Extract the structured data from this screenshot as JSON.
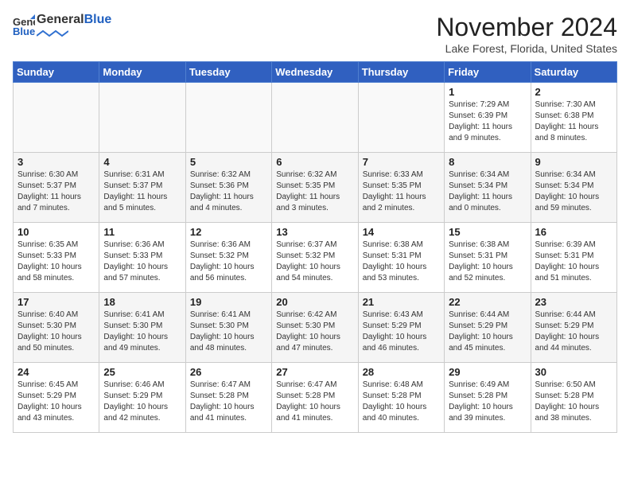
{
  "header": {
    "logo_general": "General",
    "logo_blue": "Blue",
    "month_title": "November 2024",
    "location": "Lake Forest, Florida, United States"
  },
  "days_of_week": [
    "Sunday",
    "Monday",
    "Tuesday",
    "Wednesday",
    "Thursday",
    "Friday",
    "Saturday"
  ],
  "weeks": [
    [
      {
        "day": "",
        "sunrise": "",
        "sunset": "",
        "daylight": ""
      },
      {
        "day": "",
        "sunrise": "",
        "sunset": "",
        "daylight": ""
      },
      {
        "day": "",
        "sunrise": "",
        "sunset": "",
        "daylight": ""
      },
      {
        "day": "",
        "sunrise": "",
        "sunset": "",
        "daylight": ""
      },
      {
        "day": "",
        "sunrise": "",
        "sunset": "",
        "daylight": ""
      },
      {
        "day": "1",
        "sunrise": "Sunrise: 7:29 AM",
        "sunset": "Sunset: 6:39 PM",
        "daylight": "Daylight: 11 hours and 9 minutes."
      },
      {
        "day": "2",
        "sunrise": "Sunrise: 7:30 AM",
        "sunset": "Sunset: 6:38 PM",
        "daylight": "Daylight: 11 hours and 8 minutes."
      }
    ],
    [
      {
        "day": "3",
        "sunrise": "Sunrise: 6:30 AM",
        "sunset": "Sunset: 5:37 PM",
        "daylight": "Daylight: 11 hours and 7 minutes."
      },
      {
        "day": "4",
        "sunrise": "Sunrise: 6:31 AM",
        "sunset": "Sunset: 5:37 PM",
        "daylight": "Daylight: 11 hours and 5 minutes."
      },
      {
        "day": "5",
        "sunrise": "Sunrise: 6:32 AM",
        "sunset": "Sunset: 5:36 PM",
        "daylight": "Daylight: 11 hours and 4 minutes."
      },
      {
        "day": "6",
        "sunrise": "Sunrise: 6:32 AM",
        "sunset": "Sunset: 5:35 PM",
        "daylight": "Daylight: 11 hours and 3 minutes."
      },
      {
        "day": "7",
        "sunrise": "Sunrise: 6:33 AM",
        "sunset": "Sunset: 5:35 PM",
        "daylight": "Daylight: 11 hours and 2 minutes."
      },
      {
        "day": "8",
        "sunrise": "Sunrise: 6:34 AM",
        "sunset": "Sunset: 5:34 PM",
        "daylight": "Daylight: 11 hours and 0 minutes."
      },
      {
        "day": "9",
        "sunrise": "Sunrise: 6:34 AM",
        "sunset": "Sunset: 5:34 PM",
        "daylight": "Daylight: 10 hours and 59 minutes."
      }
    ],
    [
      {
        "day": "10",
        "sunrise": "Sunrise: 6:35 AM",
        "sunset": "Sunset: 5:33 PM",
        "daylight": "Daylight: 10 hours and 58 minutes."
      },
      {
        "day": "11",
        "sunrise": "Sunrise: 6:36 AM",
        "sunset": "Sunset: 5:33 PM",
        "daylight": "Daylight: 10 hours and 57 minutes."
      },
      {
        "day": "12",
        "sunrise": "Sunrise: 6:36 AM",
        "sunset": "Sunset: 5:32 PM",
        "daylight": "Daylight: 10 hours and 56 minutes."
      },
      {
        "day": "13",
        "sunrise": "Sunrise: 6:37 AM",
        "sunset": "Sunset: 5:32 PM",
        "daylight": "Daylight: 10 hours and 54 minutes."
      },
      {
        "day": "14",
        "sunrise": "Sunrise: 6:38 AM",
        "sunset": "Sunset: 5:31 PM",
        "daylight": "Daylight: 10 hours and 53 minutes."
      },
      {
        "day": "15",
        "sunrise": "Sunrise: 6:38 AM",
        "sunset": "Sunset: 5:31 PM",
        "daylight": "Daylight: 10 hours and 52 minutes."
      },
      {
        "day": "16",
        "sunrise": "Sunrise: 6:39 AM",
        "sunset": "Sunset: 5:31 PM",
        "daylight": "Daylight: 10 hours and 51 minutes."
      }
    ],
    [
      {
        "day": "17",
        "sunrise": "Sunrise: 6:40 AM",
        "sunset": "Sunset: 5:30 PM",
        "daylight": "Daylight: 10 hours and 50 minutes."
      },
      {
        "day": "18",
        "sunrise": "Sunrise: 6:41 AM",
        "sunset": "Sunset: 5:30 PM",
        "daylight": "Daylight: 10 hours and 49 minutes."
      },
      {
        "day": "19",
        "sunrise": "Sunrise: 6:41 AM",
        "sunset": "Sunset: 5:30 PM",
        "daylight": "Daylight: 10 hours and 48 minutes."
      },
      {
        "day": "20",
        "sunrise": "Sunrise: 6:42 AM",
        "sunset": "Sunset: 5:30 PM",
        "daylight": "Daylight: 10 hours and 47 minutes."
      },
      {
        "day": "21",
        "sunrise": "Sunrise: 6:43 AM",
        "sunset": "Sunset: 5:29 PM",
        "daylight": "Daylight: 10 hours and 46 minutes."
      },
      {
        "day": "22",
        "sunrise": "Sunrise: 6:44 AM",
        "sunset": "Sunset: 5:29 PM",
        "daylight": "Daylight: 10 hours and 45 minutes."
      },
      {
        "day": "23",
        "sunrise": "Sunrise: 6:44 AM",
        "sunset": "Sunset: 5:29 PM",
        "daylight": "Daylight: 10 hours and 44 minutes."
      }
    ],
    [
      {
        "day": "24",
        "sunrise": "Sunrise: 6:45 AM",
        "sunset": "Sunset: 5:29 PM",
        "daylight": "Daylight: 10 hours and 43 minutes."
      },
      {
        "day": "25",
        "sunrise": "Sunrise: 6:46 AM",
        "sunset": "Sunset: 5:29 PM",
        "daylight": "Daylight: 10 hours and 42 minutes."
      },
      {
        "day": "26",
        "sunrise": "Sunrise: 6:47 AM",
        "sunset": "Sunset: 5:28 PM",
        "daylight": "Daylight: 10 hours and 41 minutes."
      },
      {
        "day": "27",
        "sunrise": "Sunrise: 6:47 AM",
        "sunset": "Sunset: 5:28 PM",
        "daylight": "Daylight: 10 hours and 41 minutes."
      },
      {
        "day": "28",
        "sunrise": "Sunrise: 6:48 AM",
        "sunset": "Sunset: 5:28 PM",
        "daylight": "Daylight: 10 hours and 40 minutes."
      },
      {
        "day": "29",
        "sunrise": "Sunrise: 6:49 AM",
        "sunset": "Sunset: 5:28 PM",
        "daylight": "Daylight: 10 hours and 39 minutes."
      },
      {
        "day": "30",
        "sunrise": "Sunrise: 6:50 AM",
        "sunset": "Sunset: 5:28 PM",
        "daylight": "Daylight: 10 hours and 38 minutes."
      }
    ]
  ]
}
